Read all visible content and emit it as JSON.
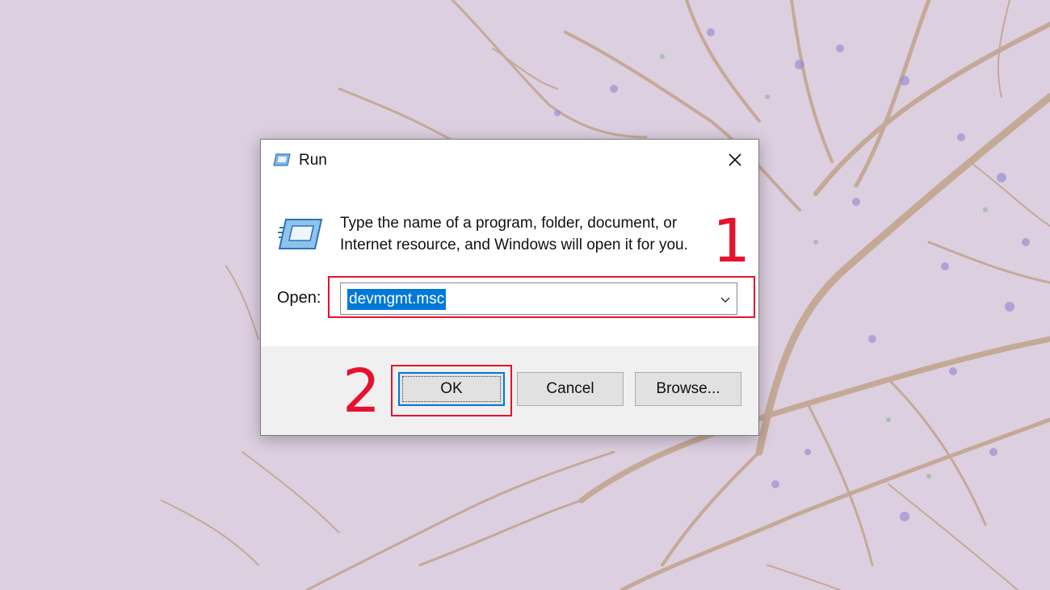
{
  "dialog": {
    "title": "Run",
    "title_icon": "run-icon",
    "close_icon": "close-icon",
    "description_line1": "Type the name of a program, folder, document, or",
    "description_line2": "Internet resource, and Windows will open it for you.",
    "open_label": "Open:",
    "open_value": "devmgmt.msc",
    "buttons": {
      "ok": "OK",
      "cancel": "Cancel",
      "browse": "Browse..."
    }
  },
  "annotations": {
    "step1": "1",
    "step2": "2",
    "color": "#e8112d"
  },
  "colors": {
    "selection": "#0078d7",
    "background": "#dccfe0",
    "button_bar": "#f0f0f0"
  }
}
